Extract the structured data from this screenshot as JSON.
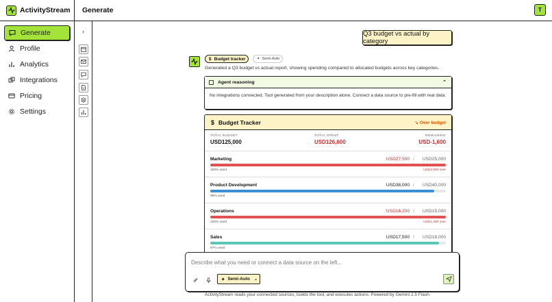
{
  "app": {
    "name": "ActivityStream"
  },
  "sidebar": {
    "items": [
      {
        "label": "Generate",
        "icon": "message-square-icon",
        "active": true
      },
      {
        "label": "Profile",
        "icon": "user-icon",
        "active": false
      },
      {
        "label": "Analytics",
        "icon": "bar-chart-icon",
        "active": false
      },
      {
        "label": "Integrations",
        "icon": "puzzle-icon",
        "active": false
      },
      {
        "label": "Pricing",
        "icon": "credit-card-icon",
        "active": false
      },
      {
        "label": "Settings",
        "icon": "gear-icon",
        "active": false
      }
    ]
  },
  "topbar": {
    "title": "Generate",
    "avatar": "T"
  },
  "rail": {
    "tools": [
      "calendar-icon",
      "mail-icon",
      "chat-icon",
      "document-icon",
      "layers-icon",
      "bar-chart-icon"
    ]
  },
  "chat": {
    "user_message": "Q3 budget vs actual by category",
    "chips": {
      "tool": "Budget tracker",
      "mode": "Semi-Auto"
    },
    "description": "Generated a Q3 budget vs actual report, showing spending compared to allocated budgets across key categories.",
    "reasoning": {
      "title": "Agent reasoning",
      "body": "No integrations connected. Tool generated from your description alone. Connect a data source to pre-fill with real data."
    }
  },
  "tracker": {
    "title": "Budget Tracker",
    "status": "Over budget",
    "totals": {
      "budget_label": "TOTAL BUDGET",
      "budget": "USD125,000",
      "spent_label": "TOTAL SPENT",
      "spent": "USD126,600",
      "remaining_label": "REMAINING",
      "remaining": "USD-1,600"
    },
    "categories": [
      {
        "name": "Marketing",
        "spent": "USD27,500",
        "budget": "USD25,000",
        "used": "100% used",
        "over": "USD2,500 over",
        "fraction": 1.0,
        "color": "#e05252",
        "is_over": true
      },
      {
        "name": "Product Development",
        "spent": "USD38,000",
        "budget": "USD40,000",
        "used": "95% used",
        "over": "",
        "fraction": 0.95,
        "color": "#3b8fd4",
        "is_over": false
      },
      {
        "name": "Operations",
        "spent": "USD16,200",
        "budget": "USD15,000",
        "used": "100% used",
        "over": "USD1,200 over",
        "fraction": 1.0,
        "color": "#e05252",
        "is_over": true
      },
      {
        "name": "Sales",
        "spent": "USD17,500",
        "budget": "USD18,000",
        "used": "97% used",
        "over": "",
        "fraction": 0.97,
        "color": "#5bc5b8",
        "is_over": false
      }
    ]
  },
  "composer": {
    "placeholder": "Describe what you need or connect a data source on the left...",
    "mode": "Semi-Auto"
  },
  "footer": "ActivityStream reads your connected sources, builds the tool, and executes actions. Powered by Gemini 2.5 Flash.",
  "colors": {
    "accent": "#a3e33a",
    "cream": "#fef3c7",
    "danger": "#d12d2d",
    "warning": "#d45a00"
  }
}
